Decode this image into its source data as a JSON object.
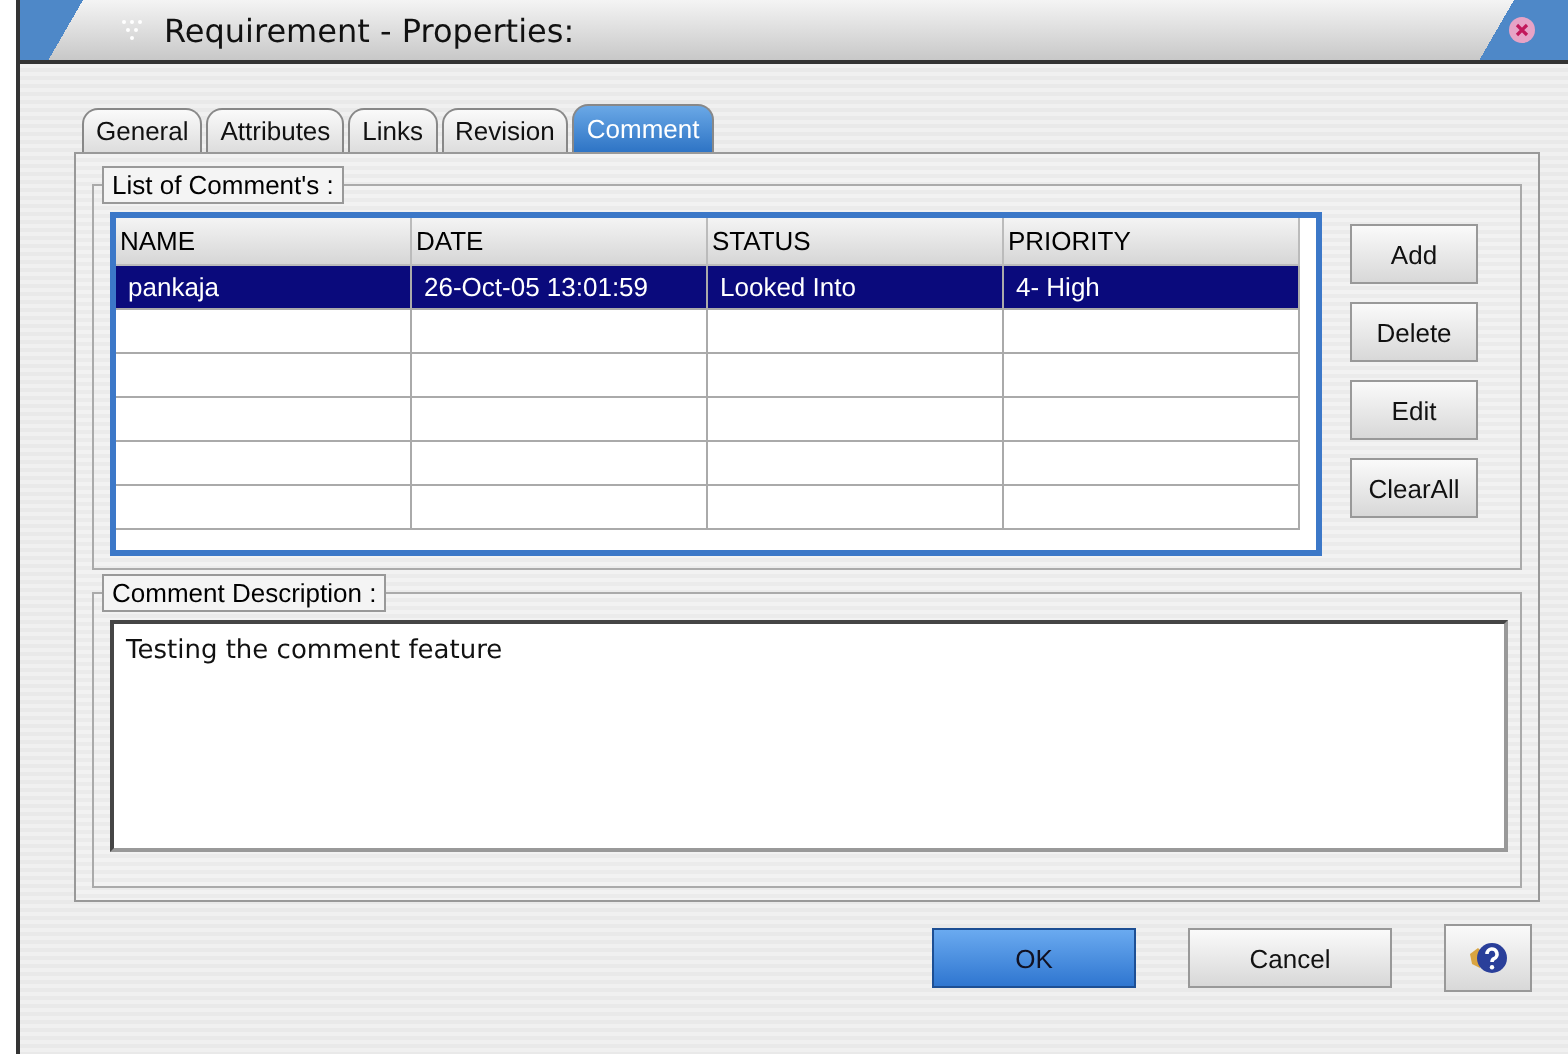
{
  "window": {
    "title": "Requirement - Properties:"
  },
  "tabs": [
    {
      "label": "General",
      "selected": false
    },
    {
      "label": "Attributes",
      "selected": false
    },
    {
      "label": "Links",
      "selected": false
    },
    {
      "label": "Revision",
      "selected": false
    },
    {
      "label": "Comment",
      "selected": true
    }
  ],
  "comments_group": {
    "label": "List of Comment's :"
  },
  "table": {
    "columns": [
      "NAME",
      "DATE",
      "STATUS",
      "PRIORITY"
    ],
    "rows": [
      {
        "cells": [
          "pankaja",
          "26-Oct-05 13:01:59",
          "Looked Into",
          "4- High"
        ],
        "selected": true
      },
      {
        "cells": [],
        "selected": false
      },
      {
        "cells": [],
        "selected": false
      },
      {
        "cells": [],
        "selected": false
      },
      {
        "cells": [],
        "selected": false
      },
      {
        "cells": [],
        "selected": false
      }
    ]
  },
  "side_buttons": [
    "Add",
    "Delete",
    "Edit",
    "ClearAll"
  ],
  "description_group": {
    "label": "Comment Description :",
    "value": "Testing the comment feature"
  },
  "buttons": [
    {
      "label": "OK",
      "kind": "default"
    },
    {
      "label": "Cancel",
      "kind": "normal"
    }
  ]
}
